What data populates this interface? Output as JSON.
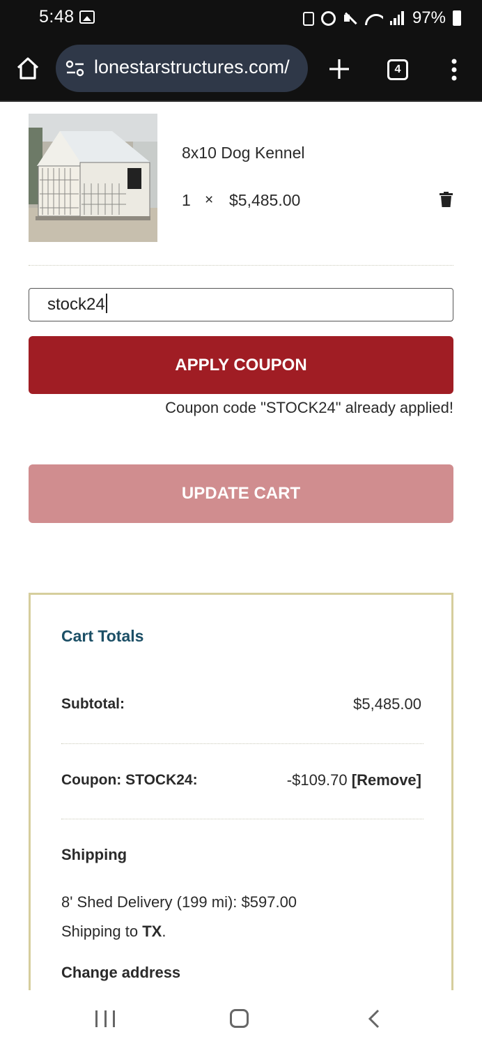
{
  "status_bar": {
    "time": "5:48",
    "battery": "97%",
    "icons": [
      "gallery-icon",
      "lock-icon",
      "alarm-icon",
      "mute-icon",
      "wifi-icon",
      "signal-icon",
      "battery-icon"
    ]
  },
  "browser": {
    "url": "lonestarstructures.com/",
    "tab_count": "4"
  },
  "cart_item": {
    "name": "8x10 Dog Kennel",
    "quantity": "1",
    "times": "×",
    "price": "$5,485.00"
  },
  "coupon": {
    "input_value": "stock24",
    "apply_label": "APPLY COUPON",
    "message": "Coupon code \"STOCK24\" already applied!"
  },
  "update_cart_label": "UPDATE CART",
  "totals": {
    "title": "Cart Totals",
    "subtotal_label": "Subtotal:",
    "subtotal_value": "$5,485.00",
    "coupon_label": "Coupon: STOCK24:",
    "coupon_value": "-$109.70",
    "coupon_remove": "[Remove]",
    "shipping_label": "Shipping",
    "shipping_method": "8' Shed Delivery (199 mi): $597.00",
    "shipping_to_prefix": "Shipping to ",
    "shipping_to_state": "TX",
    "shipping_to_suffix": ".",
    "change_address": "Change address"
  },
  "colors": {
    "apply_button": "#a01d24",
    "update_button_disabled": "#d08d8f",
    "totals_title": "#1c4f66",
    "totals_border": "#d6ce9d",
    "url_pill": "#2f3848"
  }
}
